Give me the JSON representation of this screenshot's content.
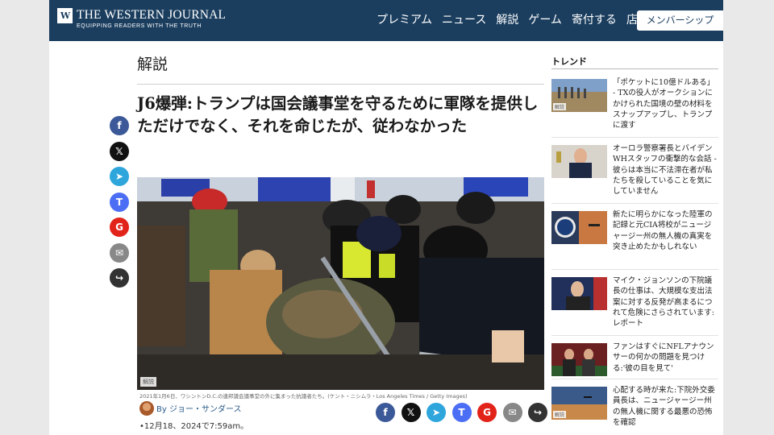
{
  "header": {
    "logo_mark": "W",
    "logo_title": "THE WESTERN JOURNAL",
    "logo_subtitle": "EQUIPPING READERS WITH THE TRUTH",
    "nav": [
      "プレミアム",
      "ニュース",
      "解説",
      "ゲーム",
      "寄付する",
      "店"
    ],
    "member_button": "メンバーシップ",
    "brand_color": "#1b3e5f"
  },
  "article": {
    "section": "解説",
    "headline": "J6爆弾:トランプは国会議事堂を守るために軍隊を提供しただけでなく、それを命じたが、従わなかった",
    "image_tag": "解説",
    "caption": "2021年1月6日、ワシントンD.C.の連邦議会議事堂の外に集まった抗議者たち。(ケント・ニシムラ・Los Angeles Times / Getty Images)",
    "byline": "By ジョー・サンダース",
    "date": "•12月18、2024で7:59am。"
  },
  "share_icons": [
    "facebook-icon",
    "x-icon",
    "telegram-icon",
    "truth-social-icon",
    "gettr-icon",
    "mail-icon",
    "share-icon"
  ],
  "share_glyphs": [
    "f",
    "𝕏",
    "➤",
    "T",
    "G",
    "✉",
    "↪"
  ],
  "trending": {
    "heading": "トレンド",
    "items": [
      {
        "text": "「ポケットに10億ドルある」 - TXの役人がオークションにかけられた国境の壁の材料をスナップアップし、トランプに渡す",
        "tag": "解説"
      },
      {
        "text": "オーロラ警察署長とバイデンWHスタッフの衝撃的な会話 - 彼らは本当に不法滞在者が私たちを殺していることを気にしていません",
        "tag": ""
      },
      {
        "text": "新たに明らかになった陸軍の記録と元CIA将校がニュージャージー州の無人機の真実を突き止めたかもしれない",
        "tag": ""
      },
      {
        "text": "マイク・ジョンソンの下院議長の仕事は、大規模な支出法案に対する反発が高まるにつれて危険にさらされています:レポート",
        "tag": ""
      },
      {
        "text": "ファンはすぐにNFLアナウンサーの何かの問題を見つける:'彼の目を見て'",
        "tag": ""
      },
      {
        "text": "心配する時が来た:下院外交委員長は、ニュージャージー州の無人機に関する最悪の恐怖を確認",
        "tag": "解説"
      }
    ]
  }
}
